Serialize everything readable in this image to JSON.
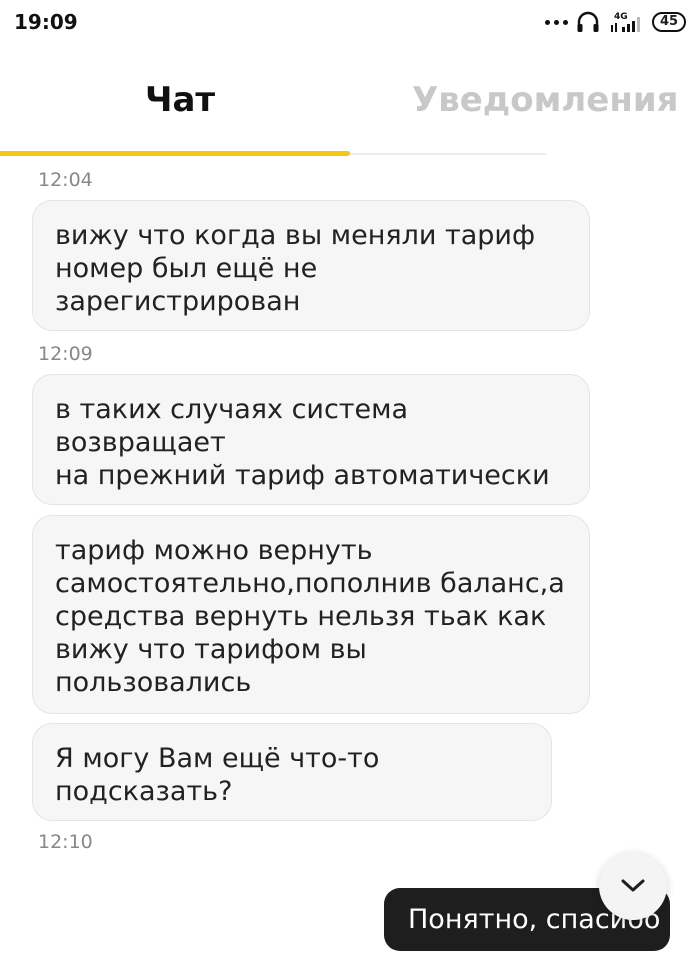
{
  "status_bar": {
    "time": "19:09",
    "network": "4G",
    "battery": "45"
  },
  "tabs": [
    {
      "label": "Чат",
      "active": true
    },
    {
      "label": "Уведомления",
      "active": false
    }
  ],
  "messages": [
    {
      "timestamp": "12:04",
      "text": "вижу что когда вы меняли тариф\nномер был ещё не зарегистрирован"
    },
    {
      "timestamp": "12:09",
      "text": "в таких случаях система возвращает\nна прежний тариф автоматически"
    },
    {
      "timestamp": "",
      "text": "тариф можно вернуть\nсамостоятельно,пополнив баланс,а\nсредства вернуть нельзя тьак как\nвижу что тарифом вы пользовались"
    },
    {
      "timestamp": "",
      "text": "Я могу Вам ещё что-то подсказать?"
    }
  ],
  "last_timestamp": "12:10",
  "quick_reply": "Понятно, спасибо",
  "icons": {
    "scroll_down": "chevron-down-icon",
    "headphones": "headphones-icon",
    "signal": "signal-icon"
  },
  "colors": {
    "accent": "#f5c518",
    "inactive_tab": "#c8c8c8",
    "bubble_bg": "#f6f6f6",
    "reply_bg": "#1e1e1e"
  }
}
